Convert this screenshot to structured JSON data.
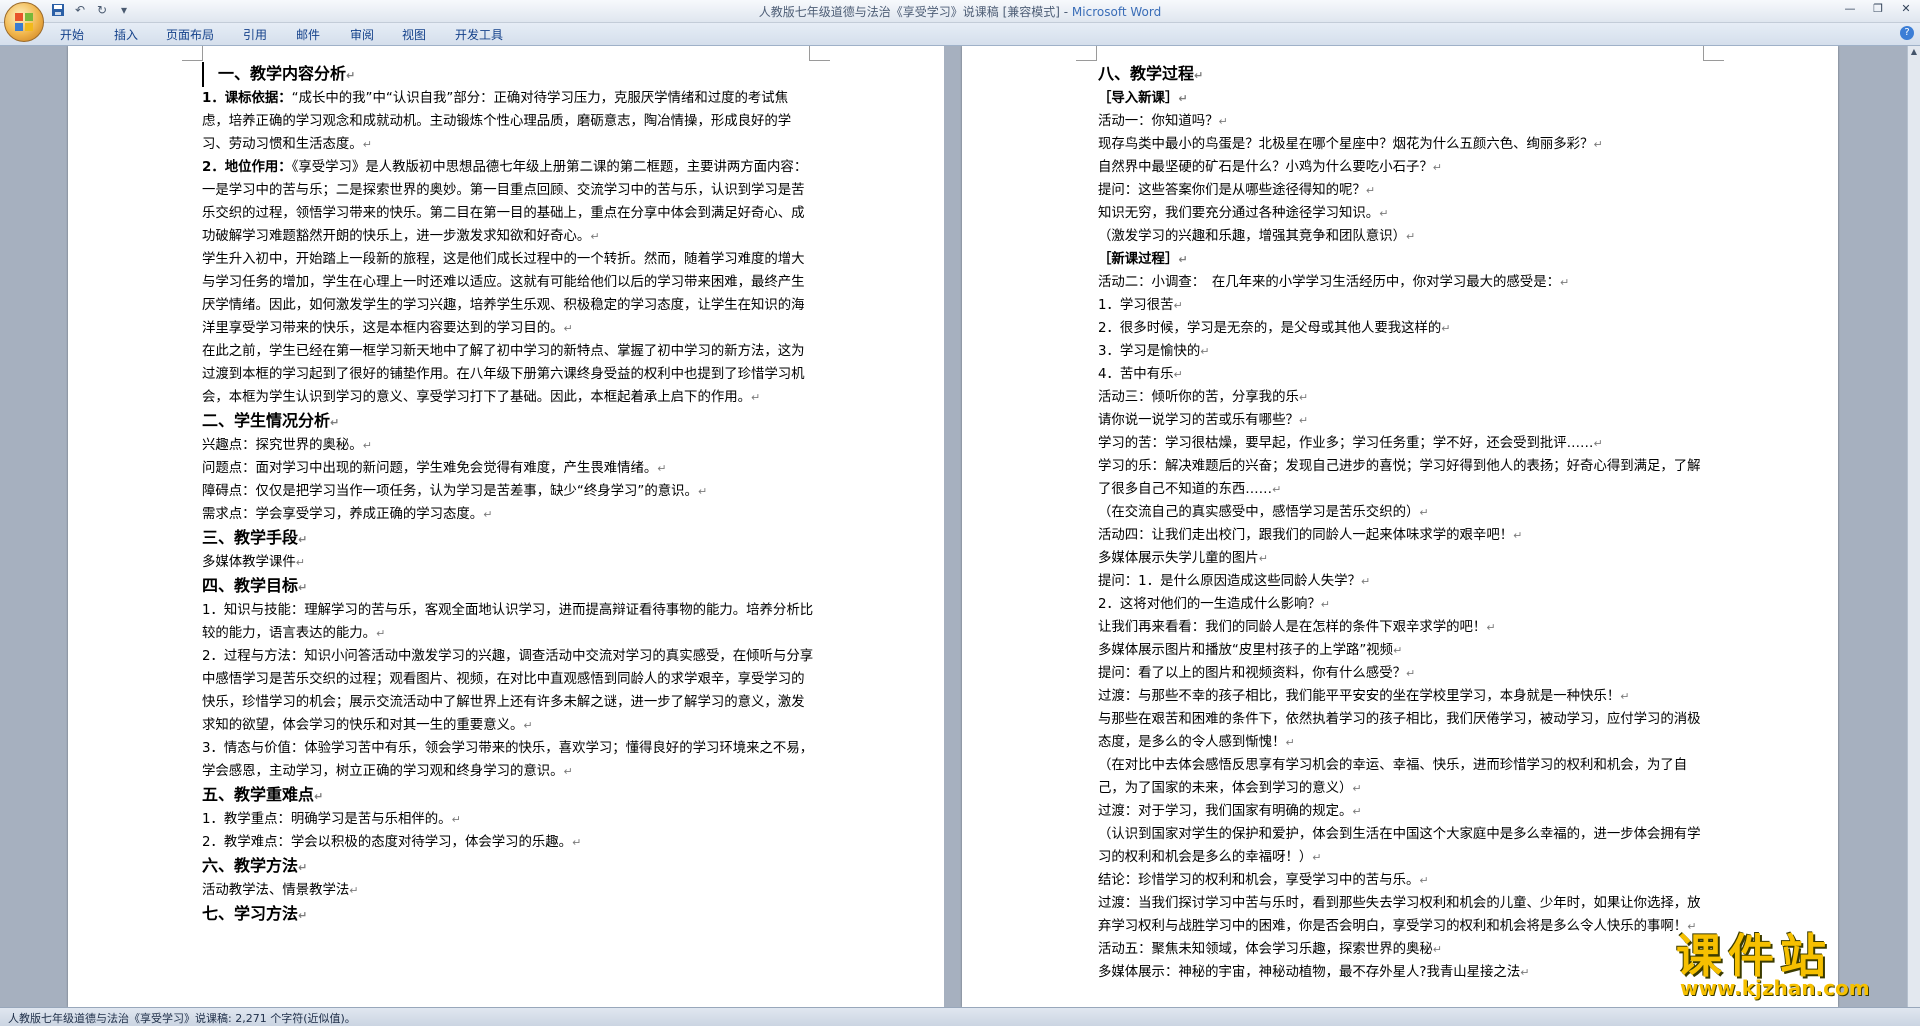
{
  "window": {
    "title": "人教版七年级道德与法治《享受学习》说课稿 [兼容模式] - ",
    "app_name": "Microsoft Word"
  },
  "ribbon": {
    "tabs": [
      "开始",
      "插入",
      "页面布局",
      "引用",
      "邮件",
      "审阅",
      "视图",
      "开发工具"
    ]
  },
  "left_page": [
    {
      "style": "h1 h-first",
      "text": "一、教学内容分析"
    },
    {
      "style": "",
      "label": "1．课标依据：",
      "text": "“成长中的我”中“认识自我”部分：正确对待学习压力，克服厌学情绪和过度的考试焦虑，培养正确的学习观念和成就动机。主动锻炼个性心理品质，磨砺意志，陶冶情操，形成良好的学习、劳动习惯和生活态度。"
    },
    {
      "style": "",
      "label": "2．地位作用：",
      "text": "《享受学习》是人教版初中思想品德七年级上册第二课的第二框题，主要讲两方面内容：一是学习中的苦与乐；二是探索世界的奥妙。第一目重点回顾、交流学习中的苦与乐，认识到学习是苦乐交织的过程，领悟学习带来的快乐。第二目在第一目的基础上，重点在分享中体会到满足好奇心、成功破解学习难题豁然开朗的快乐上，进一步激发求知欲和好奇心。"
    },
    {
      "style": "",
      "text": "学生升入初中，开始踏上一段新的旅程，这是他们成长过程中的一个转折。然而，随着学习难度的增大与学习任务的增加，学生在心理上一时还难以适应。这就有可能给他们以后的学习带来困难，最终产生厌学情绪。因此，如何激发学生的学习兴趣，培养学生乐观、积极稳定的学习态度，让学生在知识的海洋里享受学习带来的快乐，这是本框内容要达到的学习目的。"
    },
    {
      "style": "",
      "text": "在此之前，学生已经在第一框学习新天地中了解了初中学习的新特点、掌握了初中学习的新方法，这为过渡到本框的学习起到了很好的铺垫作用。在八年级下册第六课终身受益的权利中也提到了珍惜学习机会，本框为学生认识到学习的意义、享受学习打下了基础。因此，本框起着承上启下的作用。"
    },
    {
      "style": "h1",
      "text": "二、学生情况分析"
    },
    {
      "style": "",
      "text": "兴趣点：探究世界的奥秘。"
    },
    {
      "style": "",
      "text": "问题点：面对学习中出现的新问题，学生难免会觉得有难度，产生畏难情绪。"
    },
    {
      "style": "",
      "text": "障碍点：仅仅是把学习当作一项任务，认为学习是苦差事，缺少“终身学习”的意识。"
    },
    {
      "style": "",
      "text": "需求点：学会享受学习，养成正确的学习态度。"
    },
    {
      "style": "h1",
      "text": "三、教学手段"
    },
    {
      "style": "",
      "text": "多媒体教学课件"
    },
    {
      "style": "h1",
      "text": "四、教学目标"
    },
    {
      "style": "",
      "text": "1．知识与技能：理解学习的苦与乐，客观全面地认识学习，进而提高辩证看待事物的能力。培养分析比较的能力，语言表达的能力。"
    },
    {
      "style": "",
      "text": "2．过程与方法：知识小问答活动中激发学习的兴趣，调查活动中交流对学习的真实感受，在倾听与分享中感悟学习是苦乐交织的过程；观看图片、视频，在对比中直观感悟到同龄人的求学艰辛，享受学习的快乐，珍惜学习的机会；展示交流活动中了解世界上还有许多未解之谜，进一步了解学习的意义，激发求知的欲望，体会学习的快乐和对其一生的重要意义。"
    },
    {
      "style": "",
      "text": "3．情态与价值：体验学习苦中有乐，领会学习带来的快乐，喜欢学习；懂得良好的学习环境来之不易，学会感恩，主动学习，树立正确的学习观和终身学习的意识。"
    },
    {
      "style": "h1",
      "text": "五、教学重难点"
    },
    {
      "style": "",
      "text": "1．教学重点：明确学习是苦与乐相伴的。"
    },
    {
      "style": "",
      "text": "2．教学难点：学会以积极的态度对待学习，体会学习的乐趣。"
    },
    {
      "style": "h1",
      "text": "六、教学方法"
    },
    {
      "style": "",
      "text": "活动教学法、情景教学法"
    },
    {
      "style": "h1",
      "text": "七、学习方法"
    }
  ],
  "right_page": [
    {
      "style": "h1",
      "text": "八、教学过程"
    },
    {
      "style": "sub",
      "text": "［导入新课］"
    },
    {
      "style": "",
      "text": "活动一：你知道吗？"
    },
    {
      "style": "",
      "text": "现存鸟类中最小的鸟蛋是？北极星在哪个星座中？烟花为什么五颜六色、绚丽多彩？"
    },
    {
      "style": "",
      "text": "自然界中最坚硬的矿石是什么？小鸡为什么要吃小石子？"
    },
    {
      "style": "",
      "text": "提问：这些答案你们是从哪些途径得知的呢？"
    },
    {
      "style": "",
      "text": "知识无穷，我们要充分通过各种途径学习知识。"
    },
    {
      "style": "",
      "text": "（激发学习的兴趣和乐趣，增强其竞争和团队意识）"
    },
    {
      "style": "sub",
      "text": "［新课过程］"
    },
    {
      "style": "",
      "text": "活动二：小调查：　在几年来的小学学习生活经历中，你对学习最大的感受是："
    },
    {
      "style": "",
      "text": "1．学习很苦"
    },
    {
      "style": "",
      "text": "2．很多时候，学习是无奈的，是父母或其他人要我这样的"
    },
    {
      "style": "",
      "text": "3．学习是愉快的"
    },
    {
      "style": "",
      "text": "4．苦中有乐"
    },
    {
      "style": "",
      "text": "活动三：倾听你的苦，分享我的乐"
    },
    {
      "style": "",
      "text": "请你说一说学习的苦或乐有哪些？"
    },
    {
      "style": "",
      "text": "学习的苦：学习很枯燥，要早起，作业多；学习任务重；学不好，还会受到批评……"
    },
    {
      "style": "",
      "text": "学习的乐：解决难题后的兴奋；发现自己进步的喜悦；学习好得到他人的表扬；好奇心得到满足，了解了很多自己不知道的东西……"
    },
    {
      "style": "",
      "text": "（在交流自己的真实感受中，感悟学习是苦乐交织的）"
    },
    {
      "style": "",
      "text": "活动四：让我们走出校门，跟我们的同龄人一起来体味求学的艰辛吧！"
    },
    {
      "style": "",
      "text": "多媒体展示失学儿童的图片"
    },
    {
      "style": "",
      "text": "提问：1．是什么原因造成这些同龄人失学？"
    },
    {
      "style": "",
      "text": "2．这将对他们的一生造成什么影响？"
    },
    {
      "style": "",
      "text": "让我们再来看看：我们的同龄人是在怎样的条件下艰辛求学的吧！"
    },
    {
      "style": "",
      "text": "多媒体展示图片和播放“皮里村孩子的上学路”视频"
    },
    {
      "style": "",
      "text": "提问：看了以上的图片和视频资料，你有什么感受？"
    },
    {
      "style": "",
      "text": "过渡：与那些不幸的孩子相比，我们能平平安安的坐在学校里学习，本身就是一种快乐！"
    },
    {
      "style": "",
      "text": "与那些在艰苦和困难的条件下，依然执着学习的孩子相比，我们厌倦学习，被动学习，应付学习的消极态度，是多么的令人感到惭愧！"
    },
    {
      "style": "",
      "text": "（在对比中去体会感悟反思享有学习机会的幸运、幸福、快乐，进而珍惜学习的权利和机会，为了自己，为了国家的未来，体会到学习的意义）"
    },
    {
      "style": "",
      "text": "过渡：对于学习，我们国家有明确的规定。"
    },
    {
      "style": "",
      "text": "（认识到国家对学生的保护和爱护，体会到生活在中国这个大家庭中是多么幸福的，进一步体会拥有学习的权利和机会是多么的幸福呀！）"
    },
    {
      "style": "",
      "text": "结论：珍惜学习的权利和机会，享受学习中的苦与乐。"
    },
    {
      "style": "",
      "text": "过渡：当我们探讨学习中苦与乐时，看到那些失去学习权利和机会的儿童、少年时，如果让你选择，放弃学习权利与战胜学习中的困难，你是否会明白，享受学习的权利和机会将是多么令人快乐的事啊！"
    },
    {
      "style": "",
      "text": "活动五：聚焦未知领域，体会学习乐趣，探索世界的奥秘"
    },
    {
      "style": "",
      "text": "多媒体展示：神秘的宇宙，神秘动植物，最不存外星人?我青山星接之法"
    }
  ],
  "status": {
    "text": "人教版七年级道德与法治《享受学习》说课稿: 2,271 个字符(近似值)。"
  },
  "watermark": {
    "logo": "课件站",
    "url": "www.kjzhan.com"
  },
  "icons": {
    "office": "office-button-icon",
    "save": "save-icon",
    "undo": "undo-icon",
    "redo": "redo-icon",
    "help": "help-icon",
    "paragraph_mark": "↵"
  }
}
